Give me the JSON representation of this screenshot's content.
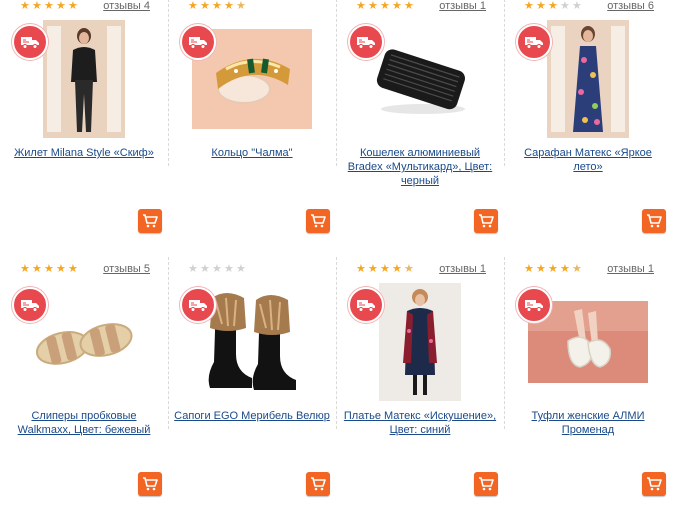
{
  "colors": {
    "accent": "#f26522",
    "delivery": "#e8494f",
    "link": "#1a4a8a",
    "star": "#f5a623"
  },
  "products": [
    {
      "rating": 5,
      "reviews": "отзывы 4",
      "title": "Жилет Milana Style «Скиф»",
      "image": "woman-in-black-outfit"
    },
    {
      "rating": 4.5,
      "reviews": "",
      "title": "Кольцо \"Чалма\"",
      "image": "gold-ring"
    },
    {
      "rating": 5,
      "reviews": "отзывы 1",
      "title": "Кошелек алюминиевый Bradex «Мультикард», Цвет: черный",
      "image": "black-card-wallet"
    },
    {
      "rating": 3,
      "reviews": "отзывы 6",
      "title": "Сарафан Матекс «Яркое лето»",
      "image": "woman-in-floral-dress"
    },
    {
      "rating": 5,
      "reviews": "отзывы 5",
      "title": "Слиперы пробковые Walkmaxx, Цвет: бежевый",
      "image": "cork-slippers"
    },
    {
      "rating": 0,
      "reviews": "",
      "title": "Сапоги EGO Мерибель Велюр",
      "image": "fur-boots"
    },
    {
      "rating": 4.5,
      "reviews": "отзывы 1",
      "title": "Платье Матекс «Искушение», Цвет: синий",
      "image": "woman-in-dress"
    },
    {
      "rating": 4.5,
      "reviews": "отзывы 1",
      "title": "Туфли женские АЛМИ Променад",
      "image": "white-shoes"
    }
  ]
}
